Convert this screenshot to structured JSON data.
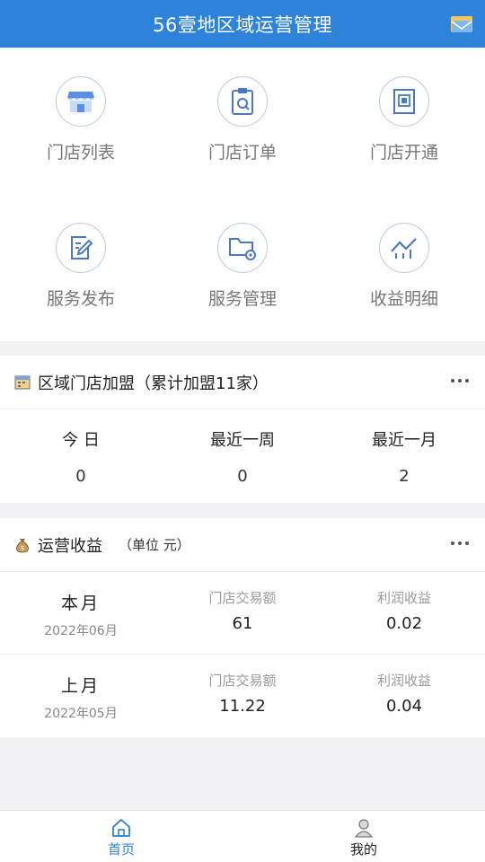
{
  "header": {
    "title": "56壹地区域运营管理",
    "message_icon": "mail-icon"
  },
  "menu": [
    {
      "label": "门店列表",
      "icon": "store-icon"
    },
    {
      "label": "门店订单",
      "icon": "clipboard-search-icon"
    },
    {
      "label": "门店开通",
      "icon": "door-icon"
    },
    {
      "label": "服务发布",
      "icon": "edit-icon"
    },
    {
      "label": "服务管理",
      "icon": "folder-settings-icon"
    },
    {
      "label": "收益明细",
      "icon": "trend-chart-icon"
    }
  ],
  "franchise": {
    "title": "区域门店加盟（累计加盟11家）",
    "stats": [
      {
        "label": "今 日",
        "value": "0"
      },
      {
        "label": "最近一周",
        "value": "0"
      },
      {
        "label": "最近一月",
        "value": "2"
      }
    ]
  },
  "revenue": {
    "title": "运营收益",
    "unit": "（单位 元）",
    "rows": [
      {
        "period": "本月",
        "date": "2022年06月",
        "amount_label": "门店交易额",
        "amount": "61",
        "profit_label": "利润收益",
        "profit": "0.02"
      },
      {
        "period": "上月",
        "date": "2022年05月",
        "amount_label": "门店交易额",
        "amount": "11.22",
        "profit_label": "利润收益",
        "profit": "0.04"
      }
    ]
  },
  "tabs": [
    {
      "label": "首页",
      "icon": "home-icon",
      "color": "#2d83d9"
    },
    {
      "label": "我的",
      "icon": "user-icon",
      "color": "#222222"
    }
  ],
  "colors": {
    "primary": "#2d83d9",
    "background": "#f2f2f4"
  }
}
